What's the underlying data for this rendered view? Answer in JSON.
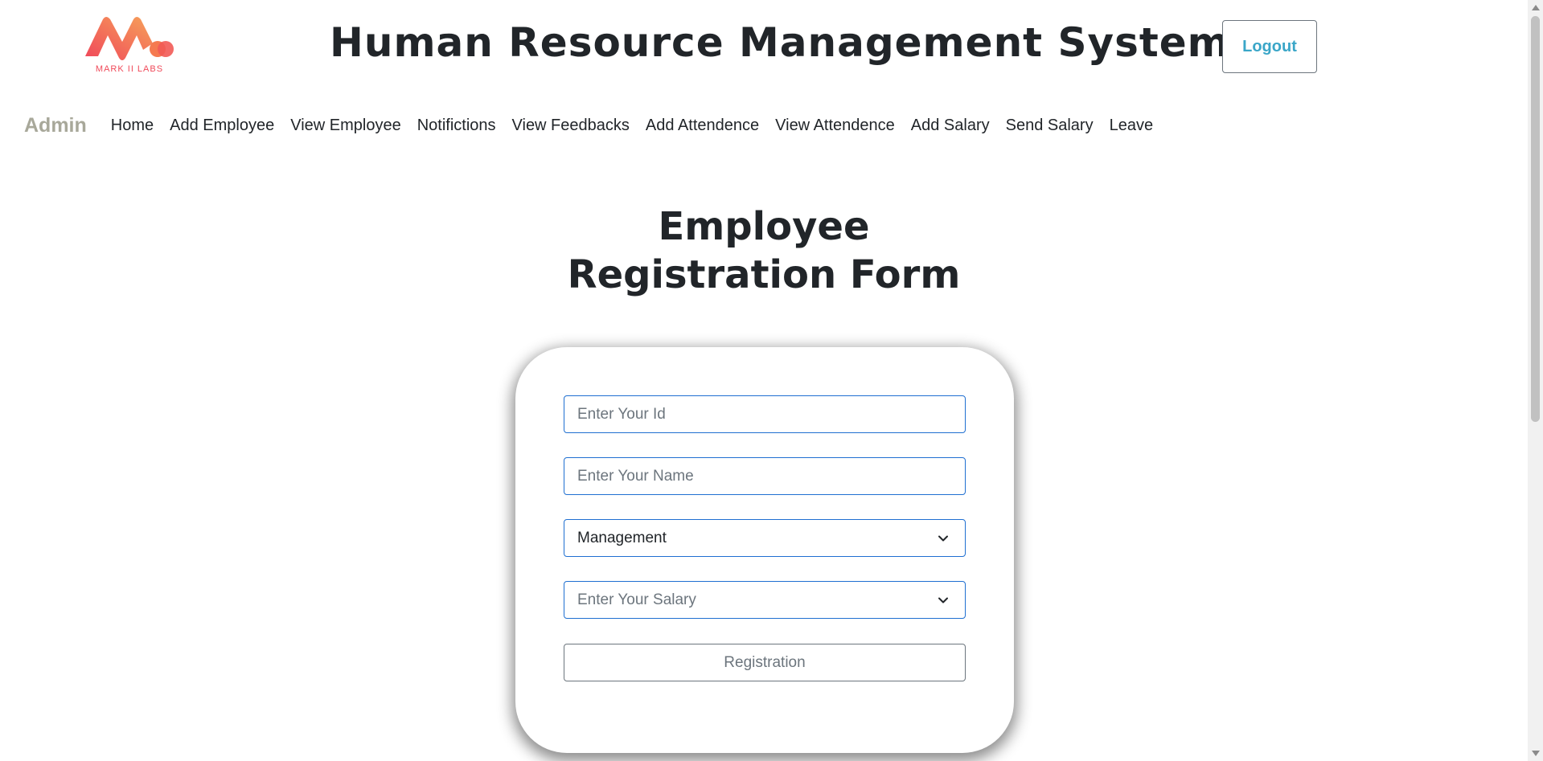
{
  "header": {
    "logo_text": "MARK II LABS",
    "title": "Human Resource Management System",
    "logout_label": "Logout"
  },
  "nav": {
    "brand": "Admin",
    "items": [
      {
        "label": "Home"
      },
      {
        "label": "Add Employee"
      },
      {
        "label": "View Employee"
      },
      {
        "label": "Notifictions"
      },
      {
        "label": "View Feedbacks"
      },
      {
        "label": "Add Attendence"
      },
      {
        "label": "View Attendence"
      },
      {
        "label": "Add Salary"
      },
      {
        "label": "Send Salary"
      },
      {
        "label": "Leave"
      }
    ]
  },
  "form": {
    "title_line1": "Employee",
    "title_line2": "Registration Form",
    "id_placeholder": "Enter Your Id",
    "name_placeholder": "Enter Your Name",
    "department_value": "Management",
    "salary_placeholder": "Enter Your Salary",
    "submit_label": "Registration"
  },
  "colors": {
    "accent_border": "#1f6fd1",
    "logout_text": "#3aa6c8",
    "brand_text": "#a8a89a",
    "logo_gradient_start": "#f04a5a",
    "logo_gradient_end": "#f7a15a"
  },
  "icons": {
    "logo": "mark-ii-labs-logo",
    "select_arrow": "chevron-down-icon"
  }
}
